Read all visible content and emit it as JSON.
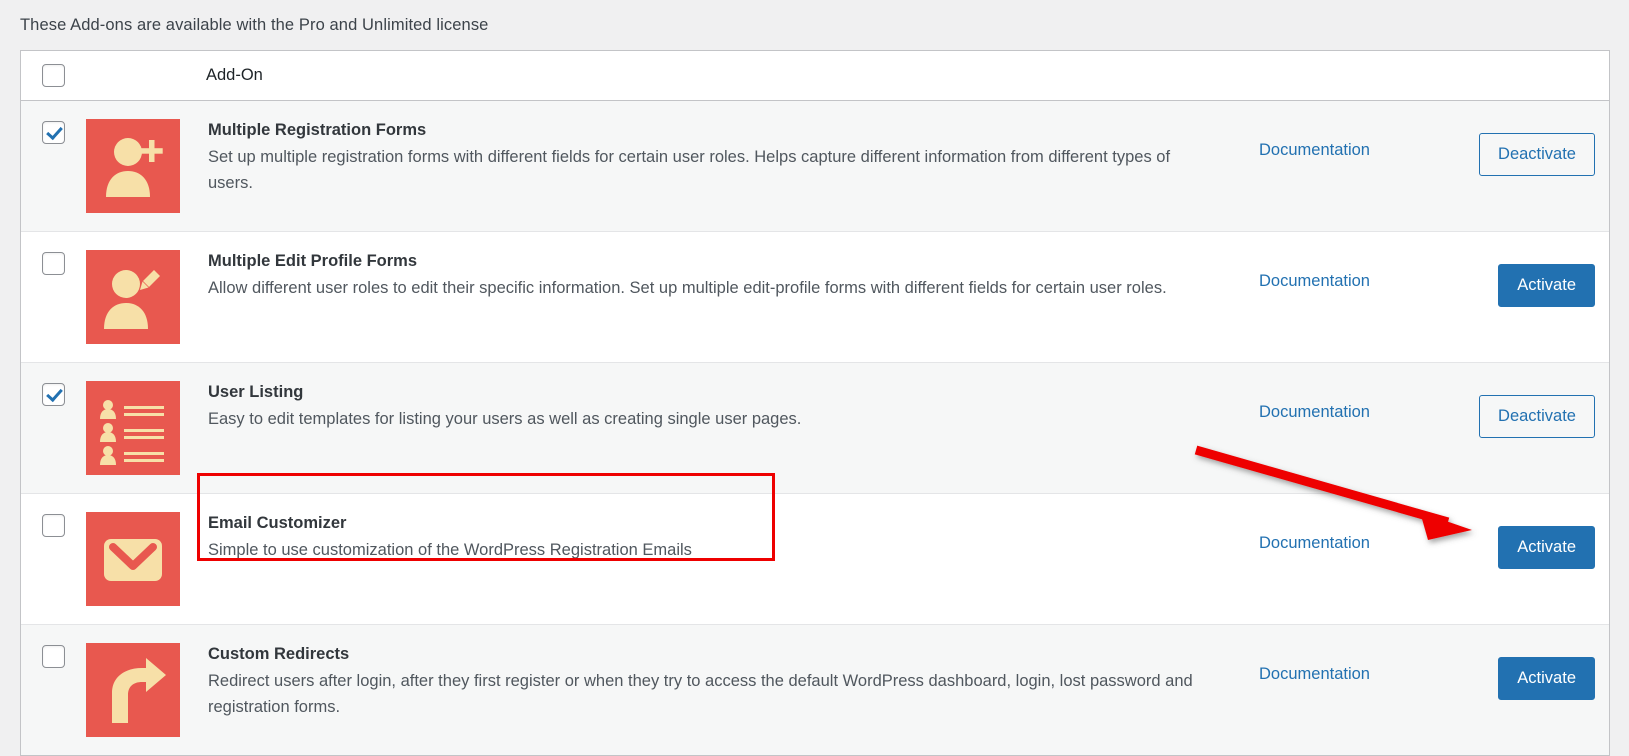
{
  "notice": "These Add-ons are available with the Pro and Unlimited license",
  "table": {
    "header": {
      "select_all_label": "",
      "column_addon": "Add-On"
    },
    "rows": [
      {
        "checked": true,
        "icon": "user-plus-icon",
        "title": "Multiple Registration Forms",
        "description": "Set up multiple registration forms with different fields for certain user roles. Helps capture different information from different types of users.",
        "doc_label": "Documentation",
        "action_label": "Deactivate",
        "action_style": "secondary"
      },
      {
        "checked": false,
        "icon": "user-edit-icon",
        "title": "Multiple Edit Profile Forms",
        "description": "Allow different user roles to edit their specific information. Set up multiple edit-profile forms with different fields for certain user roles.",
        "doc_label": "Documentation",
        "action_label": "Activate",
        "action_style": "primary"
      },
      {
        "checked": true,
        "icon": "user-list-icon",
        "title": "User Listing",
        "description": "Easy to edit templates for listing your users as well as creating single user pages.",
        "doc_label": "Documentation",
        "action_label": "Deactivate",
        "action_style": "secondary"
      },
      {
        "checked": false,
        "icon": "envelope-icon",
        "title": "Email Customizer",
        "description": "Simple to use customization of the WordPress Registration Emails",
        "doc_label": "Documentation",
        "action_label": "Activate",
        "action_style": "primary"
      },
      {
        "checked": false,
        "icon": "redirect-arrow-icon",
        "title": "Custom Redirects",
        "description": "Redirect users after login, after they first register or when they try to access the default WordPress dashboard, login, lost password and registration forms.",
        "doc_label": "Documentation",
        "action_label": "Activate",
        "action_style": "primary"
      }
    ]
  },
  "colors": {
    "accent_blue": "#2271b1",
    "icon_red": "#e8584f",
    "icon_cream": "#f7e0a8",
    "annotation_red": "#ee0000",
    "row_alt_bg": "#f6f7f7",
    "page_bg": "#f0f0f1"
  },
  "annotations": {
    "highlight_box": {
      "target": "Email Customizer",
      "color": "#ee0000"
    },
    "arrow": {
      "points_to": "Activate",
      "color": "#ee0000"
    }
  }
}
